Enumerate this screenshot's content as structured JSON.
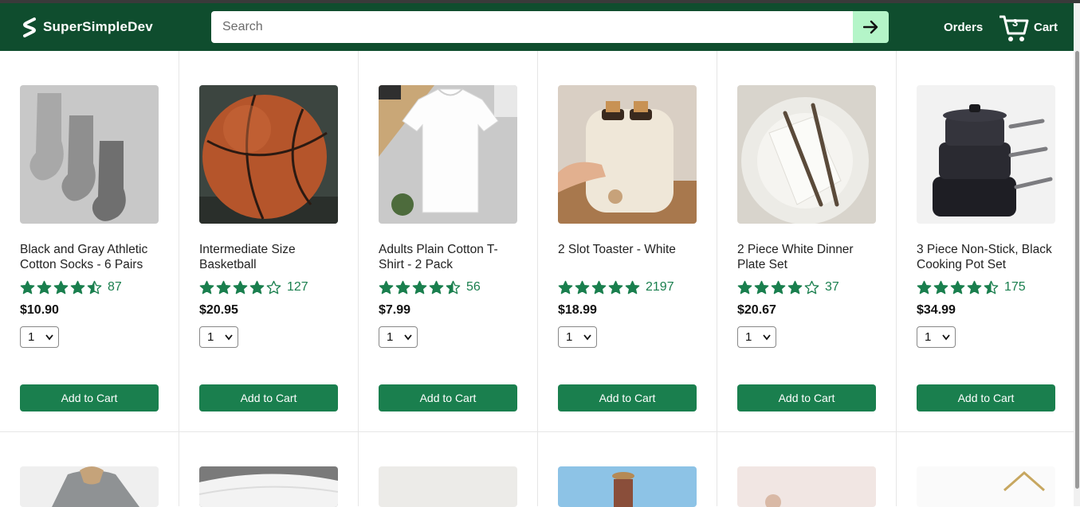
{
  "header": {
    "brand": "SuperSimpleDev",
    "search_placeholder": "Search",
    "orders_label": "Orders",
    "cart_count": "3",
    "cart_label": "Cart"
  },
  "colors": {
    "header_bg": "#0f4d2e",
    "accent_green": "#1a7f4e",
    "search_button_bg": "#b4f5c8"
  },
  "products": [
    {
      "name": "Black and Gray Athletic Cotton Socks - 6 Pairs",
      "stars": 4.5,
      "rating_count": "87",
      "price": "$10.90",
      "quantity": "1",
      "button": "Add to Cart"
    },
    {
      "name": "Intermediate Size Basketball",
      "stars": 4,
      "rating_count": "127",
      "price": "$20.95",
      "quantity": "1",
      "button": "Add to Cart"
    },
    {
      "name": "Adults Plain Cotton T-Shirt - 2 Pack",
      "stars": 4.5,
      "rating_count": "56",
      "price": "$7.99",
      "quantity": "1",
      "button": "Add to Cart"
    },
    {
      "name": "2 Slot Toaster - White",
      "stars": 5,
      "rating_count": "2197",
      "price": "$18.99",
      "quantity": "1",
      "button": "Add to Cart"
    },
    {
      "name": "2 Piece White Dinner Plate Set",
      "stars": 4,
      "rating_count": "37",
      "price": "$20.67",
      "quantity": "1",
      "button": "Add to Cart"
    },
    {
      "name": "3 Piece Non-Stick, Black Cooking Pot Set",
      "stars": 4.5,
      "rating_count": "175",
      "price": "$34.99",
      "quantity": "1",
      "button": "Add to Cart"
    }
  ]
}
